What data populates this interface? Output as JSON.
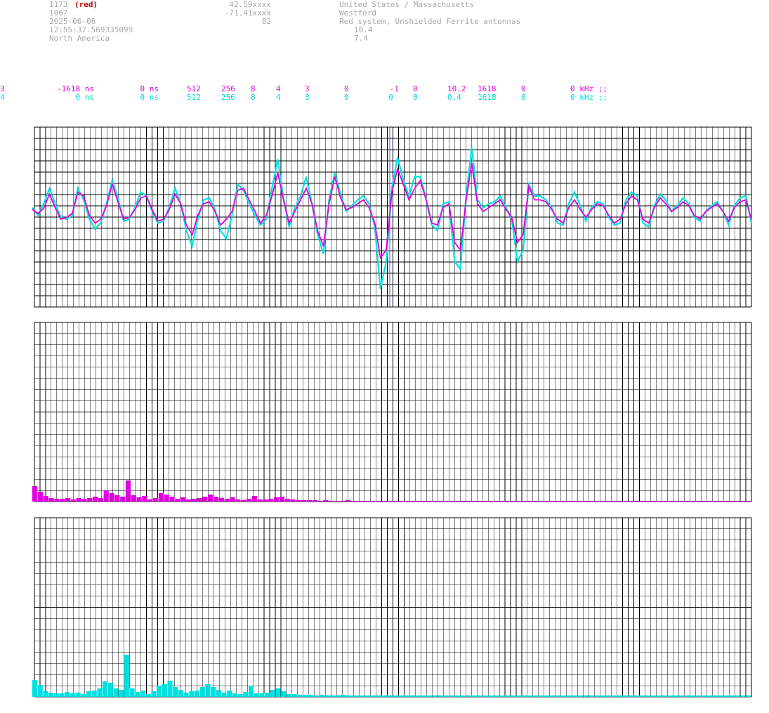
{
  "header": {
    "station_id": "1173",
    "station_tag": "(red)",
    "station2_id": "1067",
    "date": "2025-06-06",
    "time": "12:55:37.569335099",
    "region": "North America",
    "lat": "42.59xxxx",
    "lon": "-71.41xxxx",
    "alt": "82",
    "country": "United States / Massachusetts",
    "city": "Westford",
    "system": "Red system, Unshielded Ferrite antennas",
    "val1": "10.4",
    "val2": "7.4"
  },
  "params": {
    "row1": {
      "ch": "3",
      "offset": "-1618 ns",
      "delay": "0 ns",
      "n1": "512",
      "n2": "256",
      "n3": "8",
      "n4": "4",
      "n5": "3",
      "n6": "0",
      "n7": "-1",
      "n8": "0",
      "gain": "10.2",
      "n9": "1618",
      "n10": "0",
      "freq": "0 kHz ;;"
    },
    "row2": {
      "ch": "4",
      "offset": "0 ns",
      "delay": "0 ns",
      "n1": "512",
      "n2": "256",
      "n3": "8",
      "n4": "4",
      "n5": "3",
      "n6": "0",
      "n7": "0",
      "n8": "0",
      "gain": "0.4",
      "n9": "1618",
      "n10": "0",
      "freq": "0 kHz ;;"
    }
  },
  "colors": {
    "ch3": "#e000e0",
    "ch4": "#00e0e0",
    "grid": "#000000",
    "text": "#a8a8a8",
    "marker": "#5050e0"
  },
  "chart_data": [
    {
      "type": "line",
      "series": [
        {
          "values": [
            0.05,
            -0.05,
            0.08,
            0.45,
            0.1,
            -0.2,
            -0.15,
            -0.05,
            0.5,
            0.4,
            -0.1,
            -0.3,
            -0.2,
            0.15,
            0.7,
            0.25,
            -0.2,
            -0.15,
            0.05,
            0.35,
            0.4,
            0.05,
            -0.25,
            -0.2,
            0.05,
            0.45,
            0.2,
            -0.35,
            -0.6,
            -0.1,
            0.2,
            0.25,
            0.0,
            -0.35,
            -0.2,
            0.0,
            0.55,
            0.6,
            0.3,
            0.0,
            -0.3,
            -0.1,
            0.4,
            1.0,
            0.3,
            -0.3,
            0.0,
            0.3,
            0.6,
            0.2,
            -0.5,
            -0.9,
            0.2,
            0.9,
            0.35,
            0.05,
            0.1,
            0.2,
            0.3,
            0.1,
            -0.3,
            -1.2,
            -1.0,
            0.5,
            1.1,
            0.7,
            0.3,
            0.6,
            0.8,
            0.3,
            -0.3,
            -0.35,
            0.1,
            0.2,
            -0.8,
            -1.0,
            0.3,
            1.25,
            0.2,
            0.0,
            0.1,
            0.2,
            0.3,
            0.05,
            -0.15,
            -0.8,
            -0.6,
            0.65,
            0.3,
            0.3,
            0.25,
            0.05,
            -0.2,
            -0.3,
            0.1,
            0.3,
            0.05,
            -0.15,
            0.05,
            0.2,
            0.15,
            -0.1,
            -0.3,
            -0.2,
            0.2,
            0.4,
            0.3,
            -0.2,
            -0.3,
            0.1,
            0.35,
            0.2,
            0.0,
            0.1,
            0.25,
            0.15,
            -0.1,
            -0.2,
            0.0,
            0.1,
            0.2,
            0.0,
            -0.25,
            0.1,
            0.25,
            0.3,
            -0.2
          ]
        },
        {
          "values": [
            0.1,
            -0.1,
            0.2,
            0.6,
            0.2,
            -0.15,
            -0.2,
            -0.1,
            0.6,
            0.3,
            -0.2,
            -0.45,
            -0.3,
            0.2,
            0.8,
            0.35,
            -0.25,
            -0.2,
            0.1,
            0.5,
            0.4,
            0.0,
            -0.3,
            -0.25,
            0.1,
            0.6,
            0.2,
            -0.5,
            -0.9,
            -0.2,
            0.3,
            0.35,
            0.05,
            -0.5,
            -0.7,
            -0.1,
            0.7,
            0.55,
            0.2,
            -0.1,
            -0.35,
            -0.2,
            0.6,
            1.35,
            0.35,
            -0.4,
            0.1,
            0.4,
            0.9,
            0.2,
            -0.6,
            -1.1,
            0.3,
            1.0,
            0.45,
            0.0,
            0.15,
            0.3,
            0.4,
            0.2,
            -0.4,
            -2.0,
            -1.3,
            0.6,
            1.4,
            0.8,
            0.4,
            0.9,
            0.9,
            0.3,
            -0.35,
            -0.5,
            0.2,
            0.25,
            -1.3,
            -1.5,
            0.4,
            1.65,
            0.3,
            0.1,
            0.2,
            0.25,
            0.4,
            0.1,
            -0.2,
            -1.3,
            -1.0,
            0.7,
            0.4,
            0.4,
            0.3,
            0.1,
            -0.3,
            -0.35,
            0.2,
            0.5,
            0.15,
            -0.25,
            0.1,
            0.25,
            0.2,
            -0.15,
            -0.35,
            -0.3,
            0.3,
            0.5,
            0.4,
            -0.3,
            -0.4,
            0.15,
            0.45,
            0.3,
            0.0,
            0.15,
            0.35,
            0.2,
            -0.15,
            -0.25,
            0.0,
            0.15,
            0.25,
            0.0,
            -0.35,
            0.15,
            0.35,
            0.4,
            -0.3
          ]
        }
      ]
    },
    {
      "type": "bar",
      "values": [
        22,
        14,
        8,
        5,
        4,
        4,
        5,
        3,
        5,
        4,
        5,
        7,
        5,
        16,
        12,
        9,
        7,
        30,
        9,
        6,
        8,
        3,
        5,
        12,
        10,
        7,
        4,
        6,
        3,
        4,
        5,
        7,
        10,
        7,
        5,
        4,
        6,
        3,
        2,
        4,
        8,
        3,
        3,
        4,
        6,
        7,
        4,
        3,
        2,
        2,
        2,
        2,
        1,
        2,
        1,
        1,
        1,
        2,
        1,
        1,
        1,
        1,
        1,
        1,
        1,
        1,
        1,
        1,
        1,
        1,
        1,
        1,
        1,
        1,
        1,
        1,
        1,
        1,
        1,
        1,
        1,
        1,
        1,
        1,
        1,
        1,
        1,
        1,
        1,
        1,
        1,
        1,
        1,
        1,
        1,
        1,
        1,
        1,
        1,
        1,
        1,
        1,
        1,
        1,
        1,
        1,
        1,
        1,
        1,
        1,
        1,
        1,
        1,
        1,
        1,
        1,
        1,
        1,
        1,
        1,
        1,
        1,
        1,
        1,
        1,
        1,
        1,
        1,
        1,
        1,
        1
      ]
    },
    {
      "type": "bar",
      "values": [
        24,
        17,
        8,
        6,
        5,
        5,
        7,
        5,
        6,
        4,
        8,
        9,
        12,
        22,
        20,
        12,
        10,
        60,
        12,
        7,
        9,
        4,
        8,
        16,
        18,
        23,
        14,
        10,
        6,
        8,
        9,
        14,
        18,
        14,
        10,
        6,
        9,
        5,
        4,
        7,
        16,
        5,
        5,
        6,
        10,
        12,
        8,
        4,
        4,
        3,
        3,
        3,
        2,
        3,
        2,
        2,
        2,
        3,
        2,
        2,
        2,
        2,
        2,
        2,
        2,
        2,
        2,
        2,
        2,
        2,
        2,
        2,
        2,
        2,
        2,
        2,
        2,
        2,
        2,
        2,
        2,
        2,
        2,
        2,
        2,
        2,
        2,
        2,
        2,
        2,
        2,
        2,
        2,
        2,
        2,
        2,
        2,
        2,
        2,
        2,
        2,
        2,
        2,
        2,
        2,
        2,
        2,
        2,
        2,
        2,
        2,
        2,
        2,
        2,
        2,
        2,
        2,
        2,
        2,
        2,
        2,
        2,
        2,
        2,
        2,
        2,
        2,
        2,
        2,
        2,
        2,
        2,
        2
      ]
    }
  ]
}
